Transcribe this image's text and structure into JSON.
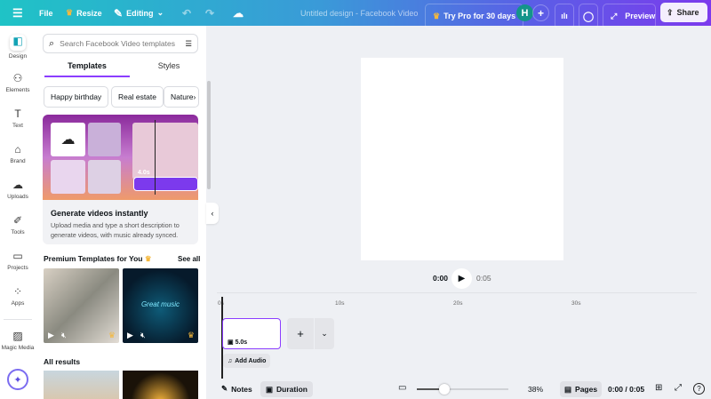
{
  "topbar": {
    "file": "File",
    "resize": "Resize",
    "editing": "Editing",
    "title": "Untitled design - Facebook Video",
    "try_pro": "Try Pro for 30 days",
    "avatar": "H",
    "preview": "Preview",
    "share": "Share"
  },
  "rail": {
    "items": [
      {
        "label": "Design"
      },
      {
        "label": "Elements"
      },
      {
        "label": "Text"
      },
      {
        "label": "Brand"
      },
      {
        "label": "Uploads"
      },
      {
        "label": "Tools"
      },
      {
        "label": "Projects"
      },
      {
        "label": "Apps"
      },
      {
        "label": "Magic Media"
      }
    ]
  },
  "panel": {
    "search_placeholder": "Search Facebook Video templates",
    "tabs": [
      "Templates",
      "Styles"
    ],
    "chips": [
      "Happy birthday",
      "Real estate",
      "Nature"
    ],
    "promo": {
      "title": "Generate videos instantly",
      "desc": "Upload media and type a short description to generate videos, with music already synced.",
      "clip_time": "4.0s"
    },
    "premium_title": "Premium Templates for You",
    "see_all": "See all",
    "music_text": "Great music",
    "all_results": "All results"
  },
  "player": {
    "current": "0:00",
    "total": "0:05"
  },
  "timeline": {
    "ticks": [
      "0s",
      "10s",
      "20s",
      "30s"
    ],
    "clip_duration": "5.0s",
    "add_audio": "Add Audio"
  },
  "bottombar": {
    "notes": "Notes",
    "duration": "Duration",
    "zoom": "38%",
    "zoom_fraction": 0.3,
    "pages": "Pages",
    "time": "0:00 / 0:05"
  },
  "colors": {
    "accent": "#7c3aed",
    "teal": "#1fc3c6"
  }
}
